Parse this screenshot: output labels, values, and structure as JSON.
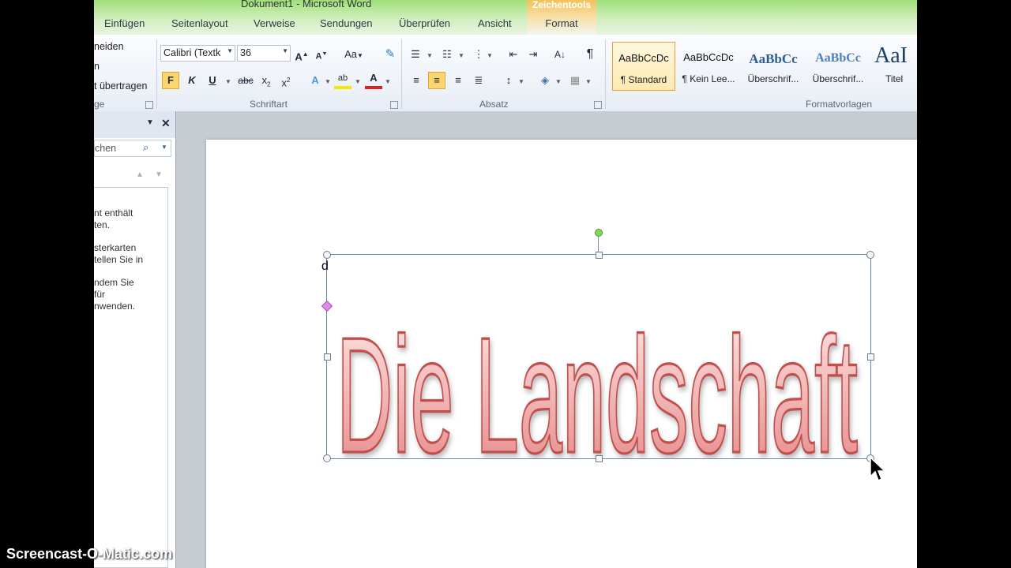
{
  "window": {
    "title": "Dokument1  -  Microsoft Word"
  },
  "tabs": [
    "Einfügen",
    "Seitenlayout",
    "Verweise",
    "Sendungen",
    "Überprüfen",
    "Ansicht"
  ],
  "context_tab": {
    "group": "Zeichentools",
    "label": "Format"
  },
  "clipboard": {
    "items": [
      "neiden",
      "n",
      "t übertragen"
    ],
    "label": "ge"
  },
  "font": {
    "name": "Calibri (Textk",
    "size": "36",
    "group_label": "Schriftart",
    "buttons": [
      "A",
      "A",
      "Aa",
      "F",
      "K",
      "U",
      "abc",
      "x",
      "x",
      "A",
      "ab",
      "A"
    ]
  },
  "paragraph": {
    "group_label": "Absatz",
    "pilcrow": "¶",
    "sort": "A↓"
  },
  "styles": {
    "group_label": "Formatvorlagen",
    "items": [
      {
        "preview": "AaBbCcDc",
        "name": "¶ Standard"
      },
      {
        "preview": "AaBbCcDc",
        "name": "¶ Kein Lee..."
      },
      {
        "preview": "AaBbCc",
        "name": "Überschrif..."
      },
      {
        "preview": "AaBbCc",
        "name": "Überschrif..."
      },
      {
        "preview": "AaI",
        "name": "Titel"
      }
    ]
  },
  "nav_pane": {
    "search_text": "chen",
    "message": [
      "nt enthält",
      "ten.",
      "",
      "sterkarten",
      "tellen Sie in",
      "",
      "ndem Sie",
      "für",
      "nwenden."
    ]
  },
  "document": {
    "cursor_char": "d",
    "wordart_text": "Die Landschaft"
  },
  "watermark": "Screencast-O-Matic.com",
  "colors": {
    "wordart_fill_top": "#fde9e8",
    "wordart_fill_bottom": "#e58383",
    "wordart_stroke": "#c0504d",
    "ribbon_bg": "#e7edf5",
    "title_green": "#9fe07a"
  }
}
